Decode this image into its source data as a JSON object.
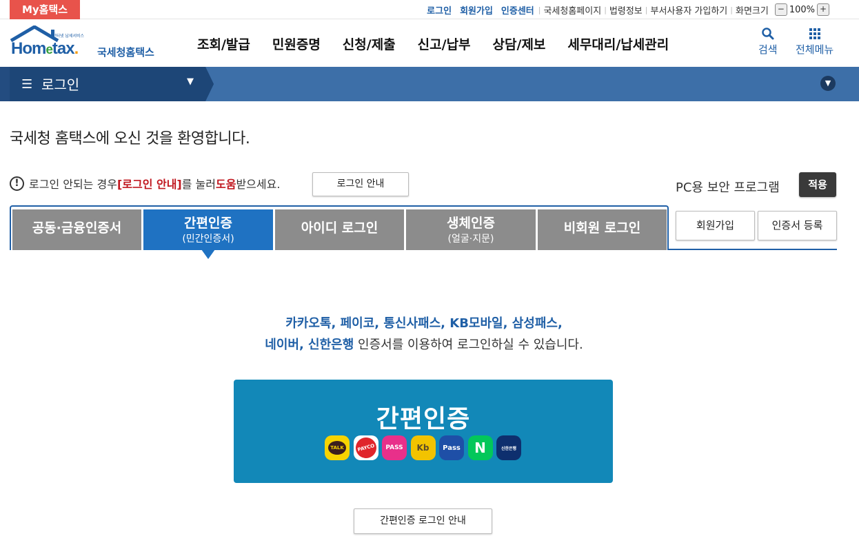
{
  "topbar": {
    "my_hometax": "My홈택스",
    "links": [
      "로그인",
      "회원가입",
      "인증센터"
    ],
    "links2": [
      "국세청홈페이지",
      "법령정보",
      "부서사용자 가입하기",
      "화면크기"
    ],
    "zoom_minus": "−",
    "zoom_value": "100%",
    "zoom_plus": "+"
  },
  "header": {
    "logo_small": "안터넷 납세서비스",
    "logo_word": "Hometax",
    "logo_brand": "국세청홈택스",
    "gnb": [
      "조회/발급",
      "민원증명",
      "신청/제출",
      "신고/납부",
      "상담/제보",
      "세무대리/납세관리"
    ],
    "search_label": "검색",
    "menu_label": "전체메뉴"
  },
  "nav": {
    "title": "로그인"
  },
  "welcome": "국세청 홈택스에 오신 것을 환영합니다.",
  "notice": {
    "pre": "로그인 안되는 경우 ",
    "highlight": "[로그인 안내]",
    "mid": "를 눌러 ",
    "help": "도움",
    "post": "받으세요.",
    "button": "로그인 안내"
  },
  "security": {
    "label": "PC용 보안 프로그램",
    "apply": "적용"
  },
  "tabs": [
    {
      "label": "공동·금융인증서",
      "sub": ""
    },
    {
      "label": "간편인증",
      "sub": "(민간인증서)"
    },
    {
      "label": "아이디 로그인",
      "sub": ""
    },
    {
      "label": "생체인증",
      "sub": "(얼굴·지문)"
    },
    {
      "label": "비회원 로그인",
      "sub": ""
    }
  ],
  "side_buttons": {
    "join": "회원가입",
    "cert": "인증서 등록"
  },
  "main": {
    "line1": "카카오톡, 페이코, 통신사패스, KB모바일, 삼성패스,",
    "line2_bold": "네이버, 신한은행",
    "line2_rest": " 인증서를 이용하여 로그인하실 수 있습니다.",
    "simple_title": "간편인증",
    "logos": [
      {
        "name": "kakaotalk",
        "text": "TALK",
        "color": "#f7d300",
        "fg": "#3b1e1e"
      },
      {
        "name": "payco",
        "text": "PAYCO",
        "color": "#ffffff",
        "fg": "#e0252b"
      },
      {
        "name": "pass",
        "text": "PASS",
        "color": "#e8308a",
        "fg": "#ffffff"
      },
      {
        "name": "kb",
        "text": "Kb",
        "color": "#f2c300",
        "fg": "#5a4a2a"
      },
      {
        "name": "samsung-pass",
        "text": "Pass",
        "color": "#1e4fa7",
        "fg": "#ffffff"
      },
      {
        "name": "naver",
        "text": "N",
        "color": "#03c75a",
        "fg": "#ffffff"
      },
      {
        "name": "shinhan",
        "text": "신한은행",
        "color": "#0e2f6e",
        "fg": "#ffffff"
      }
    ],
    "guide_button": "간편인증 로그인 안내"
  }
}
